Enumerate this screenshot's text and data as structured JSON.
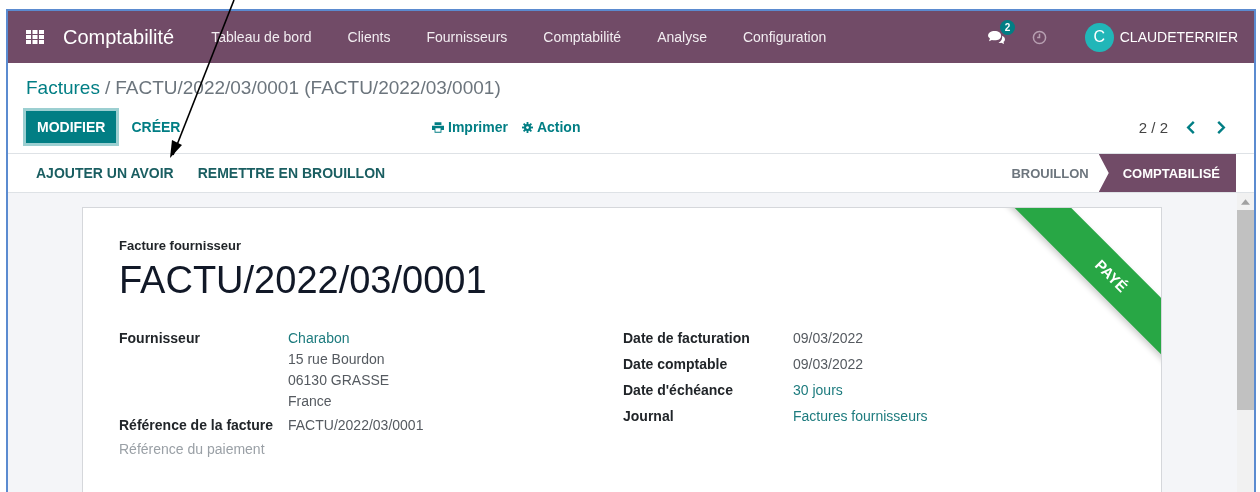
{
  "navbar": {
    "app_name": "Comptabilité",
    "menu": [
      {
        "label": "Tableau de bord"
      },
      {
        "label": "Clients"
      },
      {
        "label": "Fournisseurs"
      },
      {
        "label": "Comptabilité"
      },
      {
        "label": "Analyse"
      },
      {
        "label": "Configuration"
      }
    ],
    "message_count": "2",
    "user_initial": "C",
    "user_name": "CLAUDETERRIER"
  },
  "breadcrumb": {
    "parent": "Factures",
    "separator": "/",
    "current": "FACTU/2022/03/0001 (FACTU/2022/03/0001)"
  },
  "control_panel": {
    "edit_button": "MODIFIER",
    "create_button": "CRÉER",
    "print_menu": "Imprimer",
    "action_menu": "Action",
    "pager": "2 / 2"
  },
  "status_bar": {
    "actions": [
      "AJOUTER UN AVOIR",
      "REMETTRE EN BROUILLON"
    ],
    "stages": [
      {
        "label": "BROUILLON",
        "selected": false
      },
      {
        "label": "COMPTABILISÉ",
        "selected": true
      }
    ]
  },
  "sheet": {
    "subtitle": "Facture fournisseur",
    "title": "FACTU/2022/03/0001",
    "ribbon": "PAYÉ",
    "left_fields": [
      {
        "label": "Fournisseur",
        "empty": false,
        "lines": [
          {
            "text": "Charabon",
            "link": true
          },
          {
            "text": "15 rue Bourdon",
            "link": false
          },
          {
            "text": "06130 GRASSE",
            "link": false
          },
          {
            "text": "France",
            "link": false
          }
        ]
      },
      {
        "label": "Référence de la facture",
        "empty": false,
        "lines": [
          {
            "text": "FACTU/2022/03/0001",
            "link": false
          }
        ]
      },
      {
        "label": "Référence du paiement",
        "empty": true
      }
    ],
    "right_fields": [
      {
        "label": "Date de facturation",
        "empty": false,
        "lines": [
          {
            "text": "09/03/2022",
            "link": false
          }
        ]
      },
      {
        "label": "Date comptable",
        "empty": false,
        "lines": [
          {
            "text": "09/03/2022",
            "link": false
          }
        ]
      },
      {
        "label": "Date d'échéance",
        "empty": false,
        "lines": [
          {
            "text": "30 jours",
            "link": true
          }
        ]
      },
      {
        "label": "Journal",
        "empty": false,
        "lines": [
          {
            "text": "Factures fournisseurs",
            "link": true
          }
        ]
      }
    ]
  }
}
